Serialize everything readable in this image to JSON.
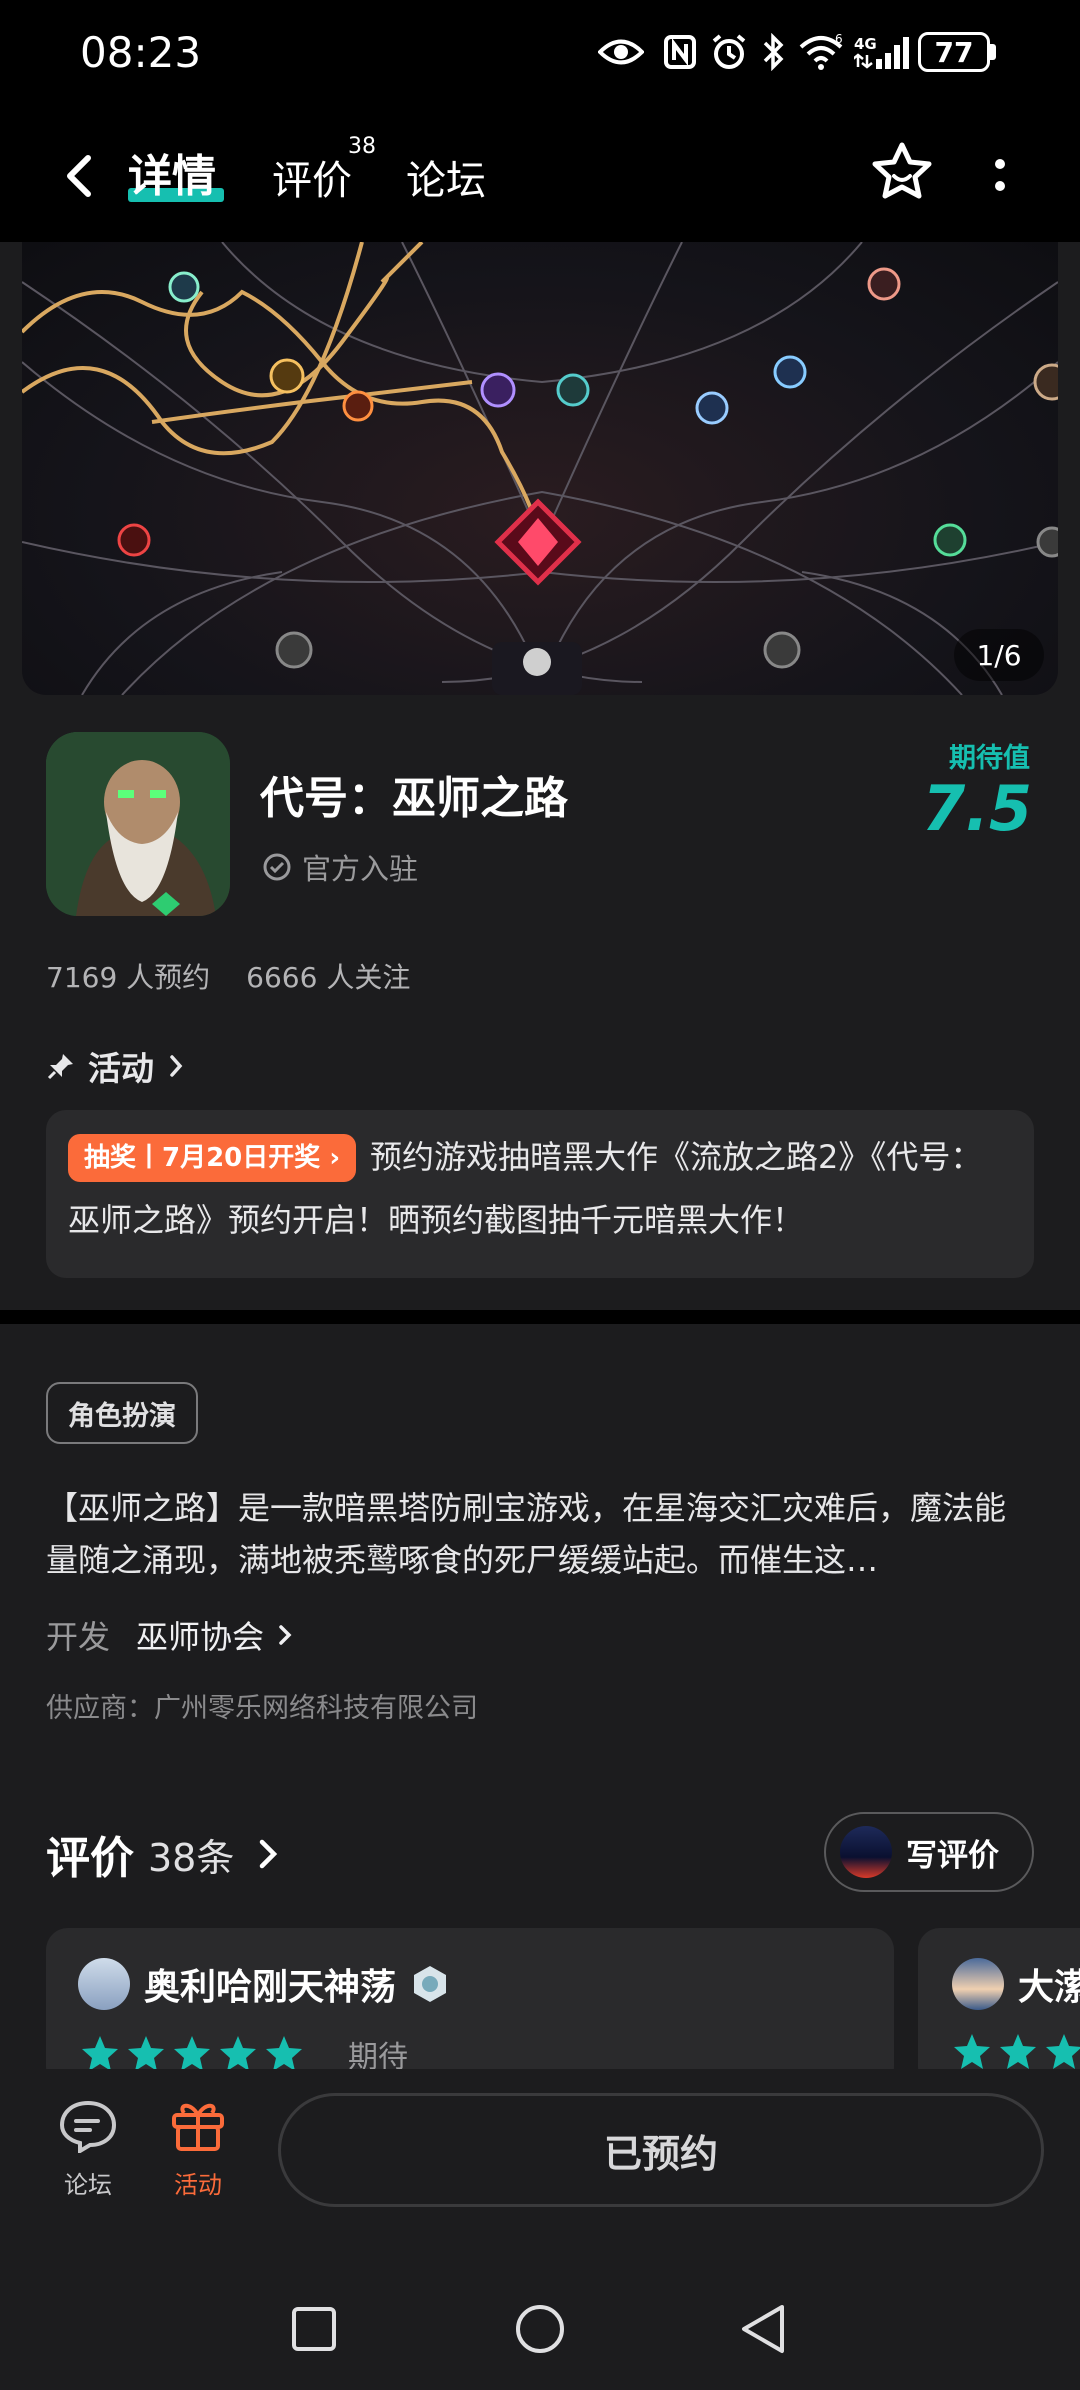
{
  "status_bar": {
    "time": "08:23",
    "battery": "77",
    "icons": [
      "eye-icon",
      "nfc-icon",
      "alarm-icon",
      "bluetooth-icon",
      "wifi-icon",
      "signal-4g-icon"
    ]
  },
  "nav": {
    "tabs": [
      {
        "label": "详情",
        "active": true
      },
      {
        "label": "评价",
        "badge": "38"
      },
      {
        "label": "论坛"
      }
    ]
  },
  "banner": {
    "counter": "1/6"
  },
  "game": {
    "title": "代号：巫师之路",
    "verified": "官方入驻",
    "expect_label": "期待值",
    "expect_value": "7.5",
    "reservations": "7169 人预约",
    "followers": "6666 人关注"
  },
  "activity": {
    "header": "活动",
    "badge": "抽奖丨7月20日开奖 ›",
    "text": "预约游戏抽暗黑大作《流放之路2》《代号：巫师之路》预约开启！晒预约截图抽千元暗黑大作！"
  },
  "info": {
    "genre": "角色扮演",
    "description": "【巫师之路】是一款暗黑塔防刷宝游戏，在星海交汇灾难后，魔法能量随之涌现，满地被秃鹫啄食的死尸缓缓站起。而催生这…",
    "developer_label": "开发",
    "developer_name": "巫师协会",
    "supplier": "供应商：广州零乐网络科技有限公司"
  },
  "reviews": {
    "title": "评价",
    "count": "38条",
    "write_button": "写评价",
    "items": [
      {
        "user": "奥利哈刚天神荡",
        "stars": 5,
        "tag": "期待"
      },
      {
        "user": "大潆",
        "stars": 5,
        "tag": ""
      }
    ]
  },
  "bottom_bar": {
    "forum_label": "论坛",
    "activity_label": "活动",
    "reserved_label": "已预约"
  },
  "colors": {
    "accent": "#16bfb0",
    "activity_orange": "#fb6b3a",
    "background": "#1c1c1e",
    "card": "#2a2a2c"
  }
}
